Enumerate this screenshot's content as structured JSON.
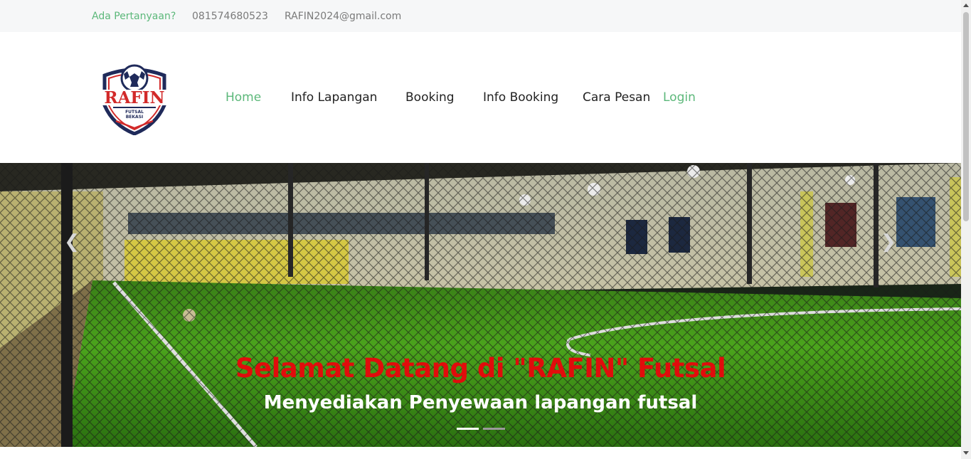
{
  "topbar": {
    "question": "Ada Pertanyaan?",
    "phone": "081574680523",
    "email": "RAFIN2024@gmail.com"
  },
  "logo": {
    "brand": "RAFIN",
    "tagline_1": "FUTSAL",
    "tagline_2": "BEKASI",
    "colors": {
      "navy": "#1f2a5a",
      "red": "#d22a2a"
    }
  },
  "nav": {
    "items": [
      {
        "label": "Home",
        "active": true
      },
      {
        "label": "Info Lapangan"
      },
      {
        "label": "Booking"
      },
      {
        "label": "Info Booking"
      },
      {
        "label": "Cara Pesan"
      },
      {
        "label": "Login"
      }
    ]
  },
  "hero": {
    "title": "Selamat Datang di \"RAFIN\" Futsal",
    "subtitle": "Menyediakan Penyewaan lapangan futsal",
    "prev_icon": "chevron-left-icon",
    "next_icon": "chevron-right-icon",
    "slide_count": 2,
    "active_slide": 1
  },
  "colors": {
    "accent_green": "#5cb87a",
    "title_red": "#e10c0c",
    "text_dark": "#222222",
    "text_muted": "#7a7a7a"
  }
}
